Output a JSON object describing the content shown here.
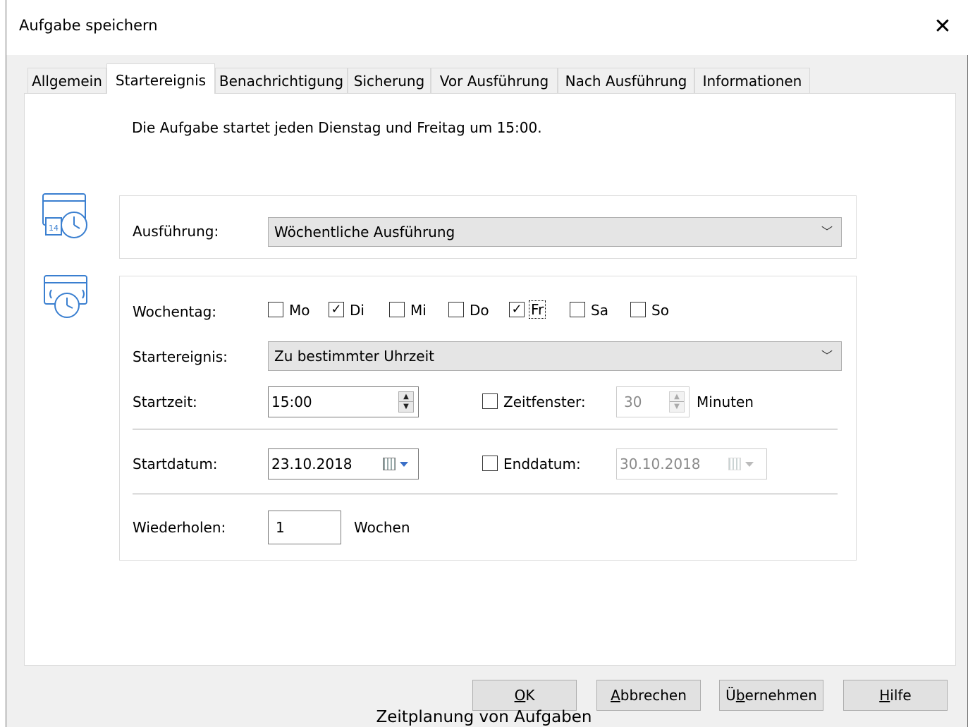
{
  "window": {
    "title": "Aufgabe speichern"
  },
  "tabs": [
    {
      "label": "Allgemein"
    },
    {
      "label": "Startereignis"
    },
    {
      "label": "Benachrichtigung"
    },
    {
      "label": "Sicherung"
    },
    {
      "label": "Vor Ausführung"
    },
    {
      "label": "Nach Ausführung"
    },
    {
      "label": "Informationen"
    }
  ],
  "summary": "Die Aufgabe startet jeden Dienstag und Freitag um 15:00.",
  "execution": {
    "label": "Ausführung:",
    "value": "Wöchentliche Ausführung"
  },
  "weekdays": {
    "label": "Wochentag:",
    "days": [
      {
        "label": "Mo",
        "checked": false
      },
      {
        "label": "Di",
        "checked": true
      },
      {
        "label": "Mi",
        "checked": false
      },
      {
        "label": "Do",
        "checked": false
      },
      {
        "label": "Fr",
        "checked": true
      },
      {
        "label": "Sa",
        "checked": false
      },
      {
        "label": "So",
        "checked": false
      }
    ]
  },
  "start_event": {
    "label": "Startereignis:",
    "value": "Zu bestimmter Uhrzeit"
  },
  "start_time": {
    "label": "Startzeit:",
    "value": "15:00"
  },
  "time_window": {
    "label": "Zeitfenster:",
    "checked": false,
    "value": "30",
    "unit": "Minuten"
  },
  "start_date": {
    "label": "Startdatum:",
    "value": "23.10.2018"
  },
  "end_date": {
    "label": "Enddatum:",
    "checked": false,
    "value": "30.10.2018"
  },
  "repeat": {
    "label": "Wiederholen:",
    "value": "1",
    "unit": "Wochen"
  },
  "buttons": {
    "ok": {
      "accel": "O",
      "rest": "K"
    },
    "cancel": {
      "accel": "A",
      "rest": "bbrechen"
    },
    "apply": {
      "pre": "Ü",
      "accel": "b",
      "rest": "ernehmen"
    },
    "help": {
      "accel": "H",
      "rest": "ilfe"
    }
  },
  "caption": "Zeitplanung von Aufgaben",
  "icons": {
    "close": "close-icon",
    "calendar_clock": "calendar-clock-icon",
    "alarm": "alarm-clock-icon",
    "combo_arrow": "chevron-down-icon"
  },
  "colors": {
    "icon_blue": "#3a7fd0",
    "dialog_bg": "#f0f0f0",
    "button_bg": "#e1e1e1"
  }
}
